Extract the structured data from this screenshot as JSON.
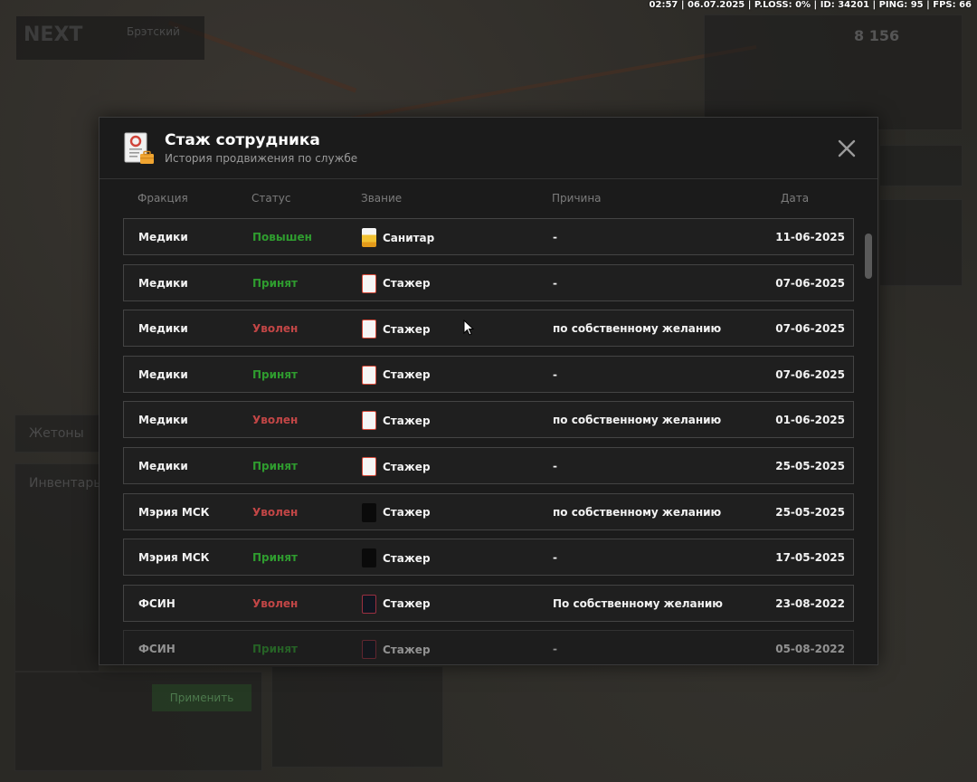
{
  "hud": {
    "text": "02:57 | 06.07.2025 | P.LOSS: 0% | ID: 34201 | PING: 95 | FPS: 66"
  },
  "background": {
    "logo_text": "NEXT",
    "location": "Брэтский",
    "money": "8 156",
    "label_tokens": "Жетоны",
    "label_inventory": "Инвентарь",
    "apply_button": "Применить"
  },
  "modal": {
    "title": "Стаж сотрудника",
    "subtitle": "История продвижения по службе",
    "icon": "document-briefcase-icon",
    "close_icon": "close-icon"
  },
  "columns": {
    "faction": "Фракция",
    "status": "Статус",
    "rank": "Звание",
    "reason": "Причина",
    "date": "Дата"
  },
  "colors": {
    "accepted": "#2f9c2f",
    "fired": "#c24646"
  },
  "rows": [
    {
      "faction": "Медики",
      "status": "Повышен",
      "status_type": "promoted",
      "rank": "Санитар",
      "badge": "medic-yellow",
      "reason": "-",
      "date": "11-06-2025"
    },
    {
      "faction": "Медики",
      "status": "Принят",
      "status_type": "accepted",
      "rank": "Стажер",
      "badge": "medic-white",
      "reason": "-",
      "date": "07-06-2025"
    },
    {
      "faction": "Медики",
      "status": "Уволен",
      "status_type": "fired",
      "rank": "Стажер",
      "badge": "medic-white",
      "reason": "по собственному желанию",
      "date": "07-06-2025"
    },
    {
      "faction": "Медики",
      "status": "Принят",
      "status_type": "accepted",
      "rank": "Стажер",
      "badge": "medic-white",
      "reason": "-",
      "date": "07-06-2025"
    },
    {
      "faction": "Медики",
      "status": "Уволен",
      "status_type": "fired",
      "rank": "Стажер",
      "badge": "medic-white",
      "reason": "по собственному желанию",
      "date": "01-06-2025"
    },
    {
      "faction": "Медики",
      "status": "Принят",
      "status_type": "accepted",
      "rank": "Стажер",
      "badge": "medic-white",
      "reason": "-",
      "date": "25-05-2025"
    },
    {
      "faction": "Мэрия МСК",
      "status": "Уволен",
      "status_type": "fired",
      "rank": "Стажер",
      "badge": "city-black",
      "reason": "по собственному желанию",
      "date": "25-05-2025"
    },
    {
      "faction": "Мэрия МСК",
      "status": "Принят",
      "status_type": "accepted",
      "rank": "Стажер",
      "badge": "city-black",
      "reason": "-",
      "date": "17-05-2025"
    },
    {
      "faction": "ФСИН",
      "status": "Уволен",
      "status_type": "fired",
      "rank": "Стажер",
      "badge": "fsin-dark",
      "reason": "По собственному желанию",
      "date": "23-08-2022"
    },
    {
      "faction": "ФСИН",
      "status": "Принят",
      "status_type": "accepted",
      "rank": "Стажер",
      "badge": "fsin-dark",
      "reason": "-",
      "date": "05-08-2022"
    }
  ]
}
